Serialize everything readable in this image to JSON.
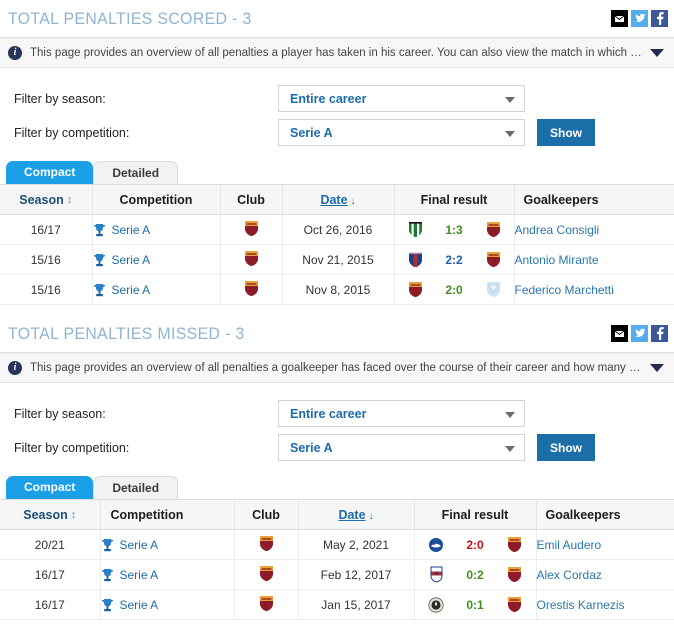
{
  "sections": [
    {
      "title": "TOTAL PENALTIES SCORED - 3",
      "info_text": "This page provides an overview of all penalties a player has taken in his career. You can also view the match in which the penalty was awarde…",
      "socials": [
        {
          "name": "email-share-icon",
          "label": "✉"
        },
        {
          "name": "twitter-share-icon",
          "label": "t"
        },
        {
          "name": "facebook-share-icon",
          "label": "f"
        }
      ],
      "filters": {
        "season_label": "Filter by season:",
        "season_value": "Entire career",
        "competition_label": "Filter by competition:",
        "competition_value": "Serie A",
        "show_button": "Show"
      },
      "tabs": [
        {
          "label": "Compact",
          "active": true
        },
        {
          "label": "Detailed",
          "active": false
        }
      ],
      "columns": [
        "Season",
        "Competition",
        "Club",
        "Date",
        "Final result",
        "Goalkeepers"
      ],
      "rows": [
        {
          "season": "16/17",
          "competition": "Serie A",
          "club": "AS Roma",
          "date": "Oct 26, 2016",
          "home_club": "Sassuolo",
          "away_club": "AS Roma",
          "score": "1:3",
          "score_type": "win",
          "goalkeeper": "Andrea Consigli"
        },
        {
          "season": "15/16",
          "competition": "Serie A",
          "club": "AS Roma",
          "date": "Nov 21, 2015",
          "home_club": "Bologna",
          "away_club": "AS Roma",
          "score": "2:2",
          "score_type": "draw",
          "goalkeeper": "Antonio Mirante"
        },
        {
          "season": "15/16",
          "competition": "Serie A",
          "club": "AS Roma",
          "date": "Nov 8, 2015",
          "home_club": "AS Roma",
          "away_club": "Lazio",
          "score": "2:0",
          "score_type": "win",
          "goalkeeper": "Federico Marchetti"
        }
      ]
    },
    {
      "title": "TOTAL PENALTIES MISSED - 3",
      "info_text": "This page provides an overview of all penalties a goalkeeper has faced over the course of their career and how many they were able to save. Y…",
      "socials": [
        {
          "name": "email-share-icon",
          "label": "✉"
        },
        {
          "name": "twitter-share-icon",
          "label": "t"
        },
        {
          "name": "facebook-share-icon",
          "label": "f"
        }
      ],
      "filters": {
        "season_label": "Filter by season:",
        "season_value": "Entire career",
        "competition_label": "Filter by competition:",
        "competition_value": "Serie A",
        "show_button": "Show"
      },
      "tabs": [
        {
          "label": "Compact",
          "active": true
        },
        {
          "label": "Detailed",
          "active": false
        }
      ],
      "columns": [
        "Season",
        "Competition",
        "Club",
        "Date",
        "Final result",
        "Goalkeepers"
      ],
      "rows": [
        {
          "season": "20/21",
          "competition": "Serie A",
          "club": "AS Roma",
          "date": "May 2, 2021",
          "home_club": "Sampdoria",
          "away_club": "AS Roma",
          "score": "2:0",
          "score_type": "loss",
          "goalkeeper": "Emil Audero"
        },
        {
          "season": "16/17",
          "competition": "Serie A",
          "club": "AS Roma",
          "date": "Feb 12, 2017",
          "home_club": "Crotone",
          "away_club": "AS Roma",
          "score": "0:2",
          "score_type": "win",
          "goalkeeper": "Alex Cordaz"
        },
        {
          "season": "16/17",
          "competition": "Serie A",
          "club": "AS Roma",
          "date": "Jan 15, 2017",
          "home_club": "Udinese",
          "away_club": "AS Roma",
          "score": "0:1",
          "score_type": "win",
          "goalkeeper": "Orestis Karnezis"
        }
      ]
    }
  ],
  "icons": {
    "sort_updown": "↕",
    "sort_down": "↓",
    "competition_icon": "trophy-icon",
    "info_icon": "i"
  },
  "colors": {
    "title": "#8fb4d0",
    "active_tab": "#1ba0e8",
    "show_button": "#1b6ea8",
    "link": "#1b6ca8",
    "win": "#3f8f1f",
    "draw": "#2060b0",
    "loss": "#c01414"
  }
}
